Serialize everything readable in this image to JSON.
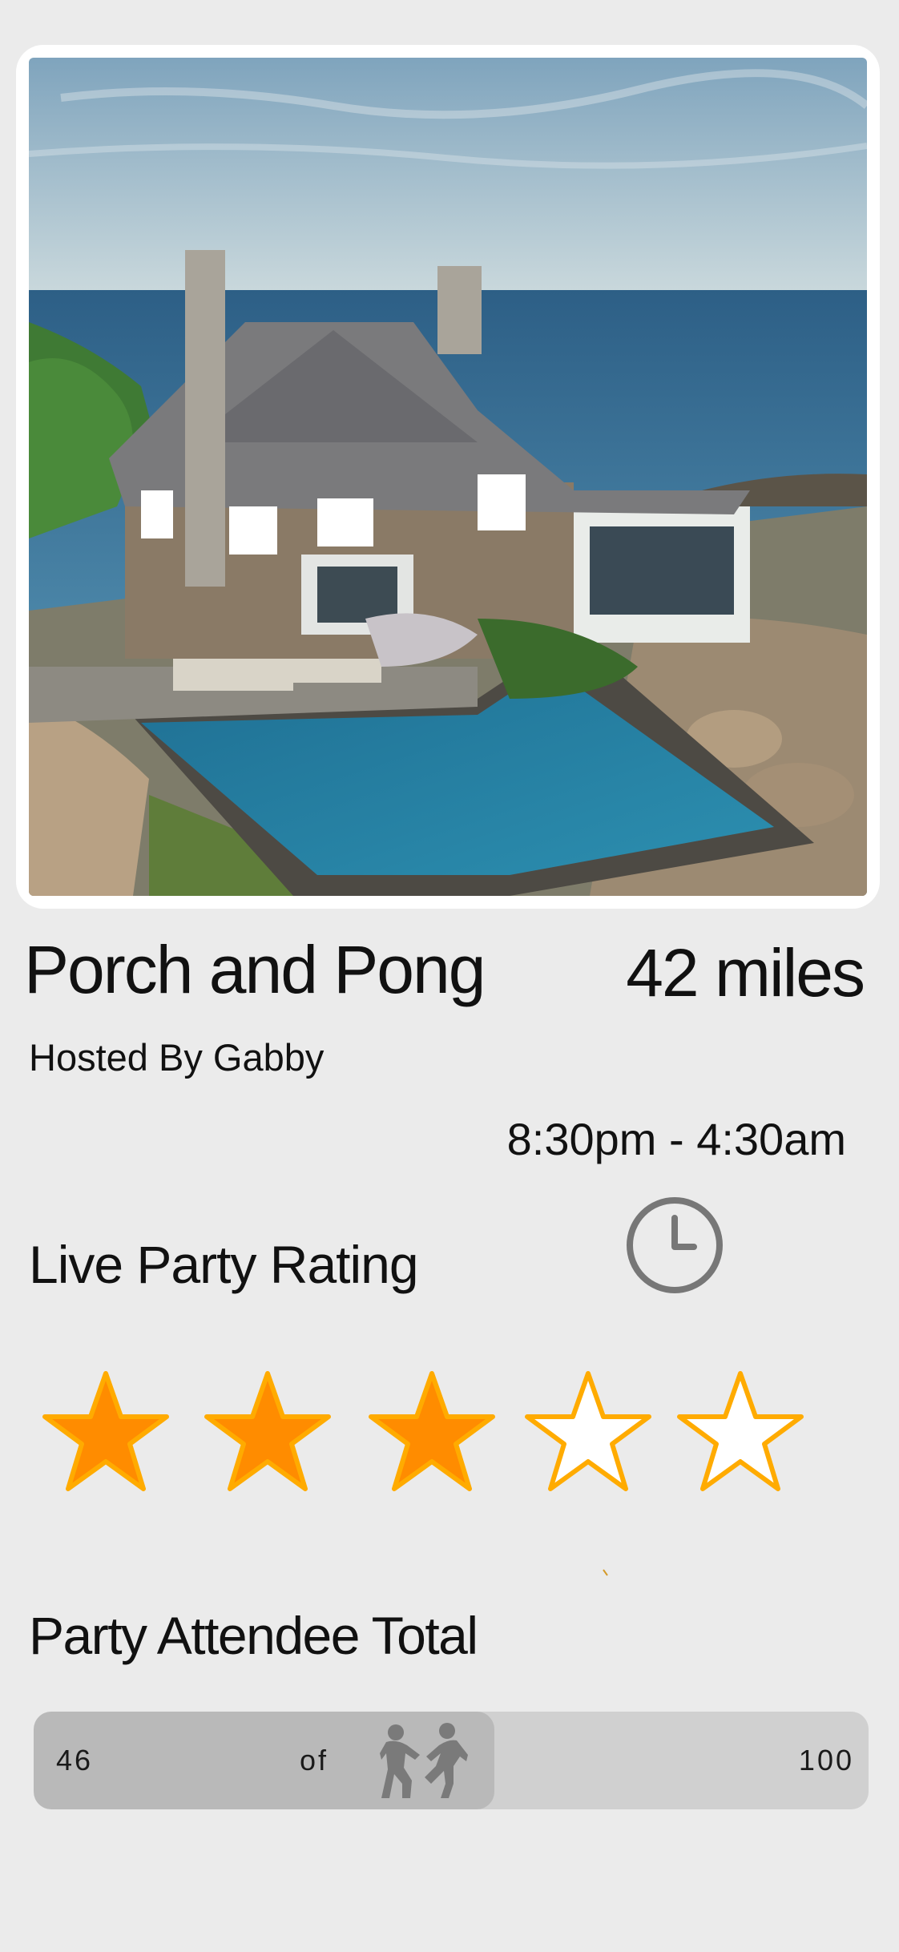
{
  "listing": {
    "photo_alt": "",
    "title": "Porch and Pong",
    "distance": "42 miles",
    "host": "Hosted By Gabby",
    "time_range": "8:30pm - 4:30am",
    "clock_icon": "clock-icon"
  },
  "rating": {
    "label": "Live Party Rating",
    "value": 3,
    "max": 5,
    "filled_color": "#ff8c00",
    "outline_color": "#ffab00",
    "empty_color": "#ffffff"
  },
  "attendance": {
    "label": "Party Attendee Total",
    "current": "46",
    "of_label": "of",
    "max": "100",
    "fill_fraction": 0.46,
    "icon": "dancing-couple-icon"
  }
}
